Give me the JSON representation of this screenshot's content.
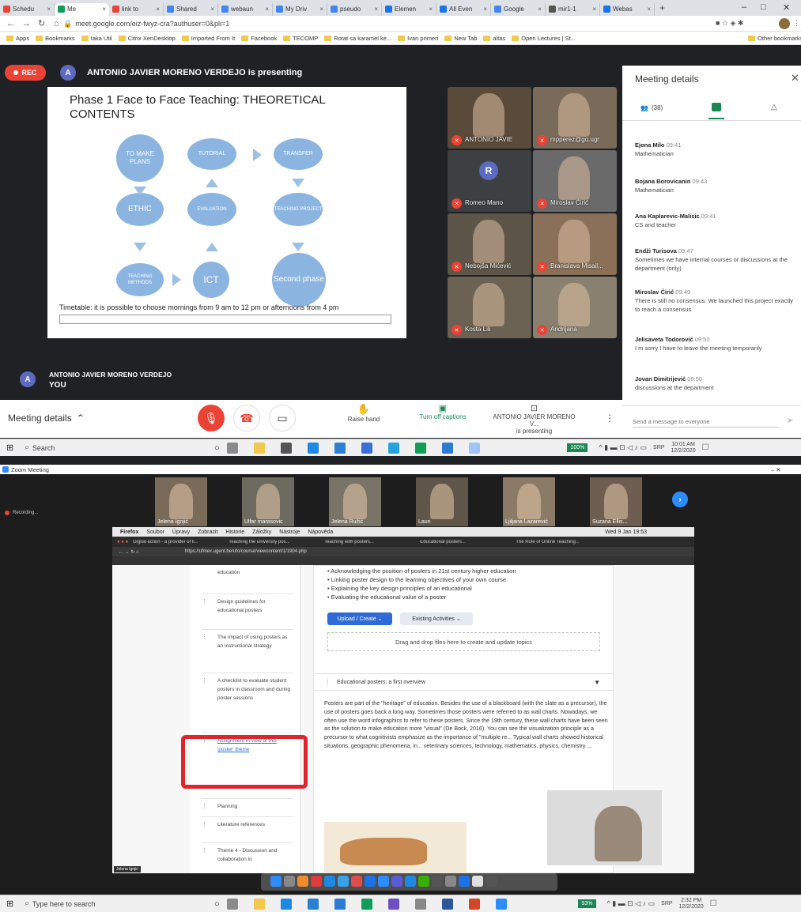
{
  "browser": {
    "tabs": [
      {
        "label": "Schedu",
        "color": "#ea4335"
      },
      {
        "label": "Me",
        "color": "#0f9d58",
        "active": true
      },
      {
        "label": "link to",
        "color": "#ea4335"
      },
      {
        "label": "Shared",
        "color": "#4285f4"
      },
      {
        "label": "webaun",
        "color": "#4285f4"
      },
      {
        "label": "My Driv",
        "color": "#4285f4"
      },
      {
        "label": "pseudo",
        "color": "#4285f4"
      },
      {
        "label": "Elemen",
        "color": "#1a73e8"
      },
      {
        "label": "All Even",
        "color": "#1a73e8"
      },
      {
        "label": "Google",
        "color": "#4285f4"
      },
      {
        "label": "mir1-1",
        "color": "#555555"
      },
      {
        "label": "Webas",
        "color": "#1a73e8"
      }
    ],
    "new_tab": "+",
    "url": "meet.google.com/eiz-fwyz-cra?authuser=0&pli=1",
    "bookmarks": [
      "Apps",
      "Bookmarks",
      "Iaka Util",
      "Citrix XenDesktop",
      "Imported From It",
      "Facebook",
      "TECOMP",
      "Rotat sa karamel ke...",
      "Ivan primeri",
      "New Tab",
      "altas",
      "Open Lectures | St..."
    ],
    "other_bookmarks": "Other bookmarks"
  },
  "meet": {
    "rec_label": "REC",
    "presenter_initial": "A",
    "presenting_text": "ANTONIO JAVIER MORENO VERDEJO is presenting",
    "slide": {
      "title": "Phase 1 Face to Face Teaching: THEORETICAL CONTENTS",
      "nodes": {
        "plans": "TO MAKE PLANS",
        "tutorial": "TUTORIAL",
        "transfer": "TRANSFER",
        "ethic": "ETHIC",
        "evaluation": "EVALUATION",
        "project": "TEACHING PROJECT",
        "methods": "TEACHING METHODS",
        "ict": "ICT",
        "second": "Second phase"
      },
      "timetable": "Timetable: it is possible to choose mornings from 9 am to 12 pm or afternoons from 4 pm"
    },
    "participants": [
      {
        "name": "ANTONIO JAVIE",
        "color": "#5a4a3a"
      },
      {
        "name": "mpperez@go.ugr",
        "color": "#7a6a5a"
      },
      {
        "name": "Romeo Mano",
        "initial": "R",
        "color": "#3c4043"
      },
      {
        "name": "Miroslav Ćirić",
        "color": "#6a6a6a"
      },
      {
        "name": "Nebojša Mićević",
        "color": "#5c5548"
      },
      {
        "name": "Branislava Misail...",
        "color": "#8a7058"
      },
      {
        "name": "Kosta Lili",
        "color": "#6b6253"
      },
      {
        "name": "Andrijana",
        "color": "#8a8070"
      }
    ],
    "you": {
      "initial": "A",
      "name": "ANTONIO JAVIER MORENO VERDEJO",
      "label": "YOU"
    },
    "controls": {
      "meeting_details": "Meeting details",
      "raise_hand": "Raise hand",
      "captions": "Turn off captions",
      "presenting_name": "ANTONIO JAVIER MORENO V...",
      "presenting_sub": "is presenting"
    },
    "panel": {
      "title": "Meeting details",
      "people_count": "(38)",
      "messages": [
        {
          "who": "Ejona Milo",
          "time": "09:41",
          "text": "Mathematician"
        },
        {
          "who": "Bojana Borovicanin",
          "time": "09:43",
          "text": "Mathematician"
        },
        {
          "who": "Ana Kaplarevic-Malisic",
          "time": "09:41",
          "text": "CS and teacher"
        },
        {
          "who": "Endži Turisova",
          "time": "09:47",
          "text": "Sometimes we have internal courses or discussions at the department (only)"
        },
        {
          "who": "Miroslav Ćirić",
          "time": "09:49",
          "text": "There is still no consensus. We launched this project exactly to reach a consensus"
        },
        {
          "who": "Jelisaveta Todorović",
          "time": "09:50",
          "text": "I m sorry I have to leave the meeting temporarily"
        },
        {
          "who": "Jovan Dimitrijević",
          "time": "09:50",
          "text": "discussions at the department"
        }
      ],
      "placeholder": "Send a message to everyone"
    }
  },
  "taskbar1": {
    "search": "Search",
    "battery": "100%",
    "lang": "SRP",
    "time": "10:01 AM",
    "date": "12/2/2020"
  },
  "zoom": {
    "window_title": "Zoom Meeting",
    "recording": "Recording...",
    "participants": [
      {
        "name": "Jelena Ignjić",
        "color": "#7a6a5a"
      },
      {
        "name": "Ulfar marasovic",
        "color": "#6d6a60"
      },
      {
        "name": "Jelena Ružić",
        "color": "#7a7468"
      },
      {
        "name": "Lauri",
        "color": "#5f5548"
      },
      {
        "name": "Ljiljana Lazarević",
        "color": "#8a7a66"
      },
      {
        "name": "Suzana Ellis...",
        "color": "#6e5e52"
      }
    ],
    "mac_menu": [
      "Firefox",
      "Soubor",
      "Úpravy",
      "Zobrazit",
      "Historie",
      "Záložky",
      "Nástroje",
      "Nápověda"
    ],
    "mac_status": "Wed 9 Jan 19:53",
    "mac_tabs": [
      "Digital action - a provider of li...",
      "Teaching the university pos...",
      "Teaching with posters...",
      "Educational posters...",
      "The Role of Online Teaching..."
    ],
    "mac_url": "https://ufmex.ugent.be/ufo/course/viewcontent/1/1904.php",
    "sidebar_items": [
      {
        "label": "education"
      },
      {
        "label": "Design guidelines for educational posters"
      },
      {
        "label": "The impact of using posters as an instructional strategy"
      },
      {
        "label": "A checklist to evaluate student posters in classroom and during poster sessions"
      },
      {
        "label": "Assignment in view of this 'poster' theme"
      },
      {
        "label": "Planning"
      },
      {
        "label": "Literature references"
      },
      {
        "label": "Theme 4 - Discussion and collaboration in"
      }
    ],
    "bullets": [
      "Acknowledging the position of posters in 21st century higher education",
      "Linking poster design to the learning objectives of your own course",
      "Explaining the key design principles of an educational",
      "Evaluating the educational value of a poster"
    ],
    "upload_btn": "Upload / Create",
    "existing_btn": "Existing Activities",
    "dropzone": "Drag and drop files here to create and update topics",
    "section_title": "Educational posters: a first overview",
    "paragraph": "Posters are part of the \"heritage\" of education. Besides the use of a blackboard (with the slate as a precursor), the use of posters goes back a long way. Sometimes those posters were referred to as wall charts. Nowadays, we often use the word infographics to refer to these posters. Since the 19th century, these wall charts have been seen as the solution to make education more \"visual\" (De Bock, 2016). You can see the visualization principle as a precursor to what cognitivists emphasize as the importance of \"multiple re... Typical wall charts showed historical situations, geographic phenomena, in... veterinary sciences, technology, mathematics, physics, chemistry ...",
    "self_label": "Jelena Ignjić"
  },
  "taskbar2": {
    "search": "Type here to search",
    "battery": "93%",
    "lang": "SRP",
    "time": "2:32 PM",
    "date": "12/2/2020"
  }
}
